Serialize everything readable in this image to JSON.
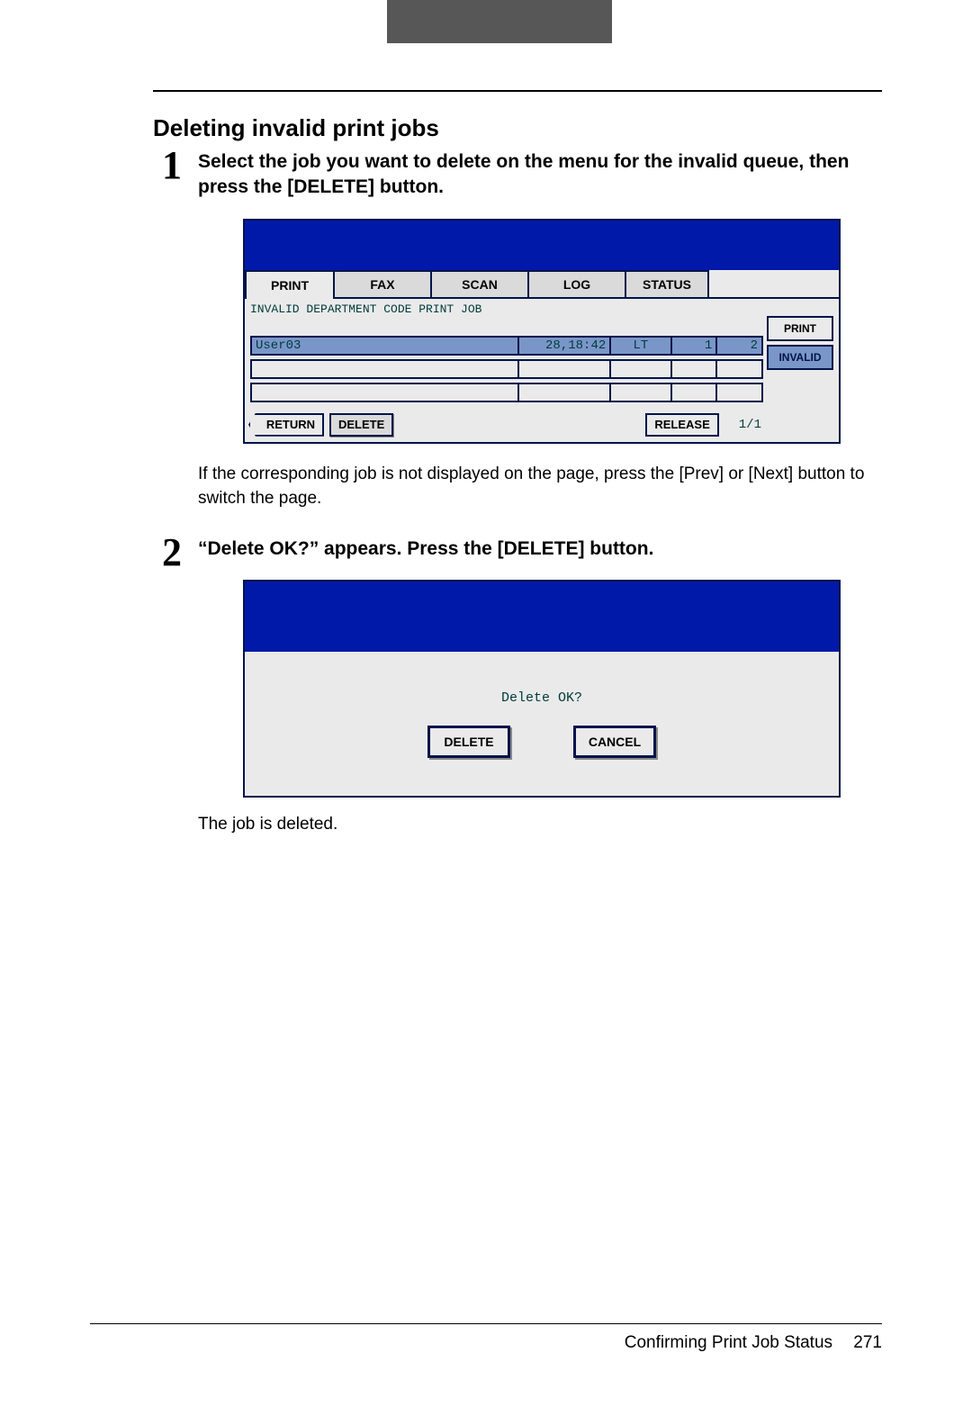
{
  "section_title": "Deleting invalid print jobs",
  "steps": [
    {
      "num": "1",
      "title": "Select the job you want to delete on the menu for the invalid queue, then press the [DELETE] button.",
      "note": "If the corresponding job is not displayed on the page, press the [Prev] or [Next] button to switch the page."
    },
    {
      "num": "2",
      "title": "“Delete OK?” appears. Press the [DELETE] button.",
      "note": "The job is deleted."
    }
  ],
  "screen1": {
    "tabs": {
      "print": "PRINT",
      "fax": "FAX",
      "scan": "SCAN",
      "log": "LOG",
      "status": "STATUS"
    },
    "subtitle": "INVALID DEPARTMENT CODE PRINT JOB",
    "side": {
      "print": "PRINT",
      "invalid": "INVALID"
    },
    "row": {
      "user": "User03",
      "time": "28,18:42",
      "size": "LT",
      "copies": "1",
      "status": "2"
    },
    "buttons": {
      "return": "RETURN",
      "delete": "DELETE",
      "release": "RELEASE"
    },
    "page": "1/1"
  },
  "screen2": {
    "ask": "Delete OK?",
    "delete": "DELETE",
    "cancel": "CANCEL"
  },
  "footer": {
    "label": "Confirming Print Job Status",
    "page": "271"
  }
}
